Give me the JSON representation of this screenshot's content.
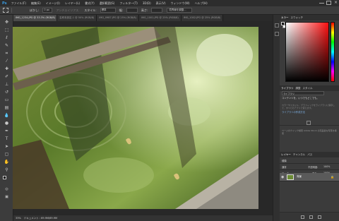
{
  "menubar": {
    "app_logo": "Ps",
    "items": [
      "ファイル(F)",
      "編集(E)",
      "イメージ(I)",
      "レイヤー(L)",
      "書式(Y)",
      "選択範囲(S)",
      "フィルター(T)",
      "3D(D)",
      "表示(V)",
      "ウィンドウ(W)",
      "ヘルプ(H)"
    ]
  },
  "options": {
    "feather_label": "ぼかし:",
    "feather_value": "0 px",
    "antialias_label": "アンチエイリアス",
    "style_label": "スタイル:",
    "style_value": "標準",
    "width_label": "幅:",
    "height_label": "高さ:",
    "refine_label": "境界線を調整..."
  },
  "tabs": [
    {
      "label": "IMG_1234.JPG @ 33.3% (RGB/8)",
      "active": true
    },
    {
      "label": "名称未設定-1 @ 50% (RGB/8)",
      "active": false
    },
    {
      "label": "IMG_0987.JPG @ 25% (RGB/8)",
      "active": false
    },
    {
      "label": "IMG_1001.JPG @ 25% (RGB/8)",
      "active": false
    },
    {
      "label": "IMG_1002.JPG @ 25% (RGB/8)",
      "active": false
    }
  ],
  "status": {
    "zoom": "33%",
    "doc_info": "ドキュメント : 69.9M/69.9M"
  },
  "color_panel": {
    "tabs": [
      "カラー",
      "スウォッチ"
    ],
    "hue_color": "#ff1010"
  },
  "library_panel": {
    "tabs": [
      "ライブラリ",
      "調整",
      "スタイル"
    ],
    "title": "ライブラリ",
    "headline": "コンテンツを、いつでもどこでも。",
    "sub": "カラーやスタイル、グラフィックをライブラリに保存して、すべてのアプリで使えます。",
    "link": "ライブラリの作成方法",
    "stock_text": "ページのクイック検索 Adobe Stock の高品質な写真を検索"
  },
  "layers_panel": {
    "tabs": [
      "レイヤー",
      "チャンネル",
      "パス"
    ],
    "kind_label": "種類",
    "blend_mode": "通常",
    "opacity_label": "不透明度:",
    "opacity_value": "100%",
    "lock_label": "ロック:",
    "fill_label": "塗り:",
    "fill_value": "100%",
    "layer_name": "背景"
  },
  "tools": [
    "move-tool-icon",
    "marquee-tool-icon",
    "lasso-tool-icon",
    "quick-select-tool-icon",
    "crop-tool-icon",
    "eyedropper-tool-icon",
    "healing-brush-icon",
    "brush-tool-icon",
    "clone-stamp-icon",
    "history-brush-icon",
    "eraser-tool-icon",
    "gradient-tool-icon",
    "blur-tool-icon",
    "dodge-tool-icon",
    "pen-tool-icon",
    "type-tool-icon",
    "path-select-icon",
    "shape-tool-icon",
    "hand-tool-icon",
    "zoom-tool-icon"
  ]
}
